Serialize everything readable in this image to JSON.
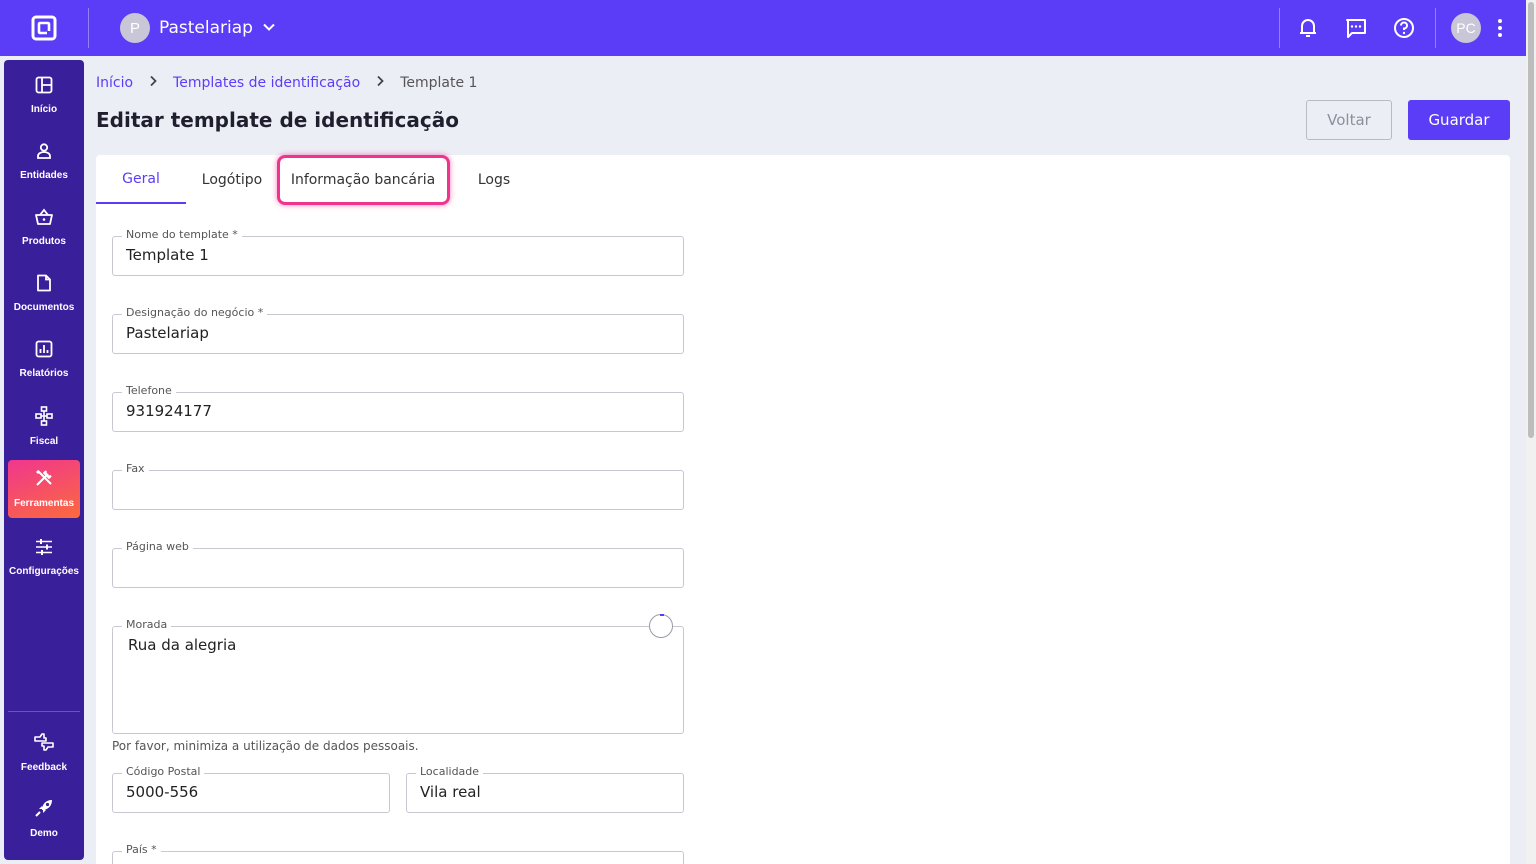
{
  "topbar": {
    "org_initial": "P",
    "org_name": "Pastelariap",
    "user_initials": "PC",
    "icons": [
      "bell-icon",
      "message-icon",
      "help-icon",
      "more-vert-icon"
    ]
  },
  "sidebar": {
    "items": [
      {
        "label": "Início",
        "icon": "dashboard-icon"
      },
      {
        "label": "Entidades",
        "icon": "person-icon"
      },
      {
        "label": "Produtos",
        "icon": "basket-icon"
      },
      {
        "label": "Documentos",
        "icon": "document-icon"
      },
      {
        "label": "Relatórios",
        "icon": "chart-icon"
      },
      {
        "label": "Fiscal",
        "icon": "hierarchy-icon"
      },
      {
        "label": "Ferramentas",
        "icon": "tools-icon",
        "active": true
      },
      {
        "label": "Configurações",
        "icon": "sliders-icon"
      }
    ],
    "bottom": [
      {
        "label": "Feedback",
        "icon": "feedback-icon"
      },
      {
        "label": "Demo",
        "icon": "rocket-icon"
      }
    ]
  },
  "breadcrumb": {
    "home": "Início",
    "section": "Templates de identificação",
    "current": "Template 1"
  },
  "page": {
    "title": "Editar template de identificação",
    "back_label": "Voltar",
    "save_label": "Guardar"
  },
  "tabs": [
    "Geral",
    "Logótipo",
    "Informação bancária",
    "Logs"
  ],
  "form": {
    "template_name": {
      "label": "Nome do template *",
      "value": "Template 1"
    },
    "business_name": {
      "label": "Designação do negócio *",
      "value": "Pastelariap"
    },
    "phone": {
      "label": "Telefone",
      "value": "931924177"
    },
    "fax": {
      "label": "Fax",
      "value": ""
    },
    "website": {
      "label": "Página web",
      "value": ""
    },
    "address": {
      "label": "Morada",
      "value": "Rua da alegria"
    },
    "helper": "Por favor, minimiza a utilização de dados pessoais.",
    "postal_code": {
      "label": "Código Postal",
      "value": "5000-556"
    },
    "locality": {
      "label": "Localidade",
      "value": "Vila real"
    },
    "country": {
      "label": "País *",
      "value": ""
    }
  },
  "colors": {
    "brand": "#5b3cf7",
    "sidebar": "#3a1f9a",
    "highlight": "#f0338e"
  }
}
